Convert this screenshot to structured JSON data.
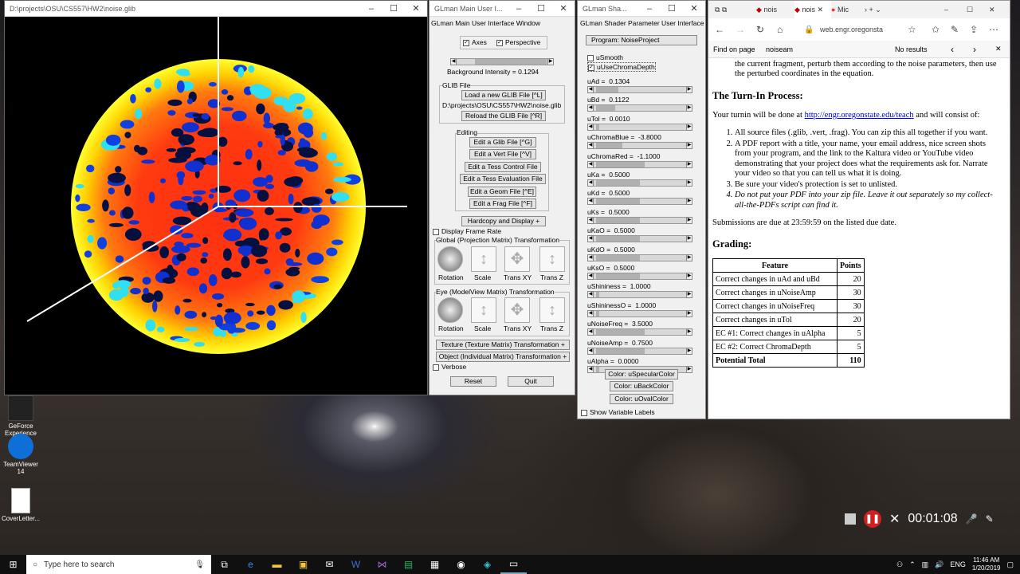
{
  "desktop": {
    "icons": [
      {
        "label": "GeForce Experience"
      },
      {
        "label": "TeamViewer 14"
      },
      {
        "label": "CoverLetter..."
      }
    ]
  },
  "gl_window": {
    "title": "D:\\projects\\OSU\\CS557\\HW2\\noise.glib"
  },
  "main_ui": {
    "title": "GLman Main User I...",
    "inner_title": "GLman Main User Interface Window",
    "axes": "Axes",
    "perspective": "Perspective",
    "bg_intensity": "Background Intensity = 0.1294",
    "glib_file_label": "GLIB File",
    "load_glib": "Load a new GLIB File [^L]",
    "glib_path": "D:\\projects\\OSU\\CS557\\HW2\\noise.glib",
    "reload_glib": "Reload the GLIB File [^R]",
    "editing_label": "Editing",
    "edit_glib": "Edit a Glib File [^G]",
    "edit_vert": "Edit a Vert File [^V]",
    "edit_tess_control": "Edit a Tess Control File",
    "edit_tess_eval": "Edit a Tess Evaluation File",
    "edit_geom": "Edit a Geom File [^E]",
    "edit_frag": "Edit a Frag File [^F]",
    "hardcopy": "Hardcopy and Display +",
    "display_frame_rate": "Display Frame Rate",
    "global_transform": "Global (Projection Matrix) Transformation",
    "eye_transform": "Eye (ModelView Matrix) Transformation",
    "tools": [
      "Rotation",
      "Scale",
      "Trans XY",
      "Trans Z"
    ],
    "texture_transform": "Texture (Texture Matrix) Transformation +",
    "object_transform": "Object (Individual Matrix) Transformation +",
    "verbose": "Verbose",
    "reset": "Reset",
    "quit": "Quit"
  },
  "shader_ui": {
    "title": "GLman Sha...",
    "inner_title": "GLman Shader Parameter User Interface",
    "program": "Program: NoiseProject",
    "usmooth": "uSmooth",
    "uusechroma": "uUseChromaDepth",
    "params": [
      {
        "label": "uAd =",
        "value": "0.1304",
        "fill": 0.25
      },
      {
        "label": "uBd =",
        "value": "0.1122",
        "fill": 0.22
      },
      {
        "label": "uTol =",
        "value": "0.0010",
        "fill": 0.02
      },
      {
        "label": "uChromaBlue =",
        "value": "-3.8000",
        "fill": 0.3
      },
      {
        "label": "uChromaRed =",
        "value": "-1.1000",
        "fill": 0.55
      },
      {
        "label": "uKa =",
        "value": "0.5000",
        "fill": 0.5
      },
      {
        "label": "uKd =",
        "value": "0.5000",
        "fill": 0.5
      },
      {
        "label": "uKs =",
        "value": "0.5000",
        "fill": 0.5
      },
      {
        "label": "uKaO =",
        "value": "0.5000",
        "fill": 0.5
      },
      {
        "label": "uKdO =",
        "value": "0.5000",
        "fill": 0.5
      },
      {
        "label": "uKsO =",
        "value": "0.5000",
        "fill": 0.5
      },
      {
        "label": "uShininess =",
        "value": "1.0000",
        "fill": 0.02
      },
      {
        "label": "uShininessO =",
        "value": "1.0000",
        "fill": 0.02
      },
      {
        "label": "uNoiseFreq =",
        "value": "3.5000",
        "fill": 0.55
      },
      {
        "label": "uNoiseAmp =",
        "value": "0.7500",
        "fill": 0.55
      },
      {
        "label": "uAlpha =",
        "value": "0.0000",
        "fill": 0.0
      }
    ],
    "color_specular": "Color: uSpecularColor",
    "color_back": "Color: uBackColor",
    "color_oval": "Color: uOvalColor",
    "show_var_labels": "Show Variable Labels"
  },
  "browser": {
    "tabs": [
      "nois",
      "nois",
      "Mic"
    ],
    "url": "web.engr.oregonsta",
    "find_label": "Find on page",
    "find_value": "noiseam",
    "find_results": "No results",
    "para_cut": "the current fragment, perturb them according to the noise parameters, then use the perturbed coordinates in the equation.",
    "turnin_heading": "The Turn-In Process:",
    "turnin_p1": "Your turnin will be done at",
    "turnin_link": "http://engr.oregonstate.edu/teach",
    "turnin_p2": "and will consist of:",
    "list": [
      "All source files (.glib, .vert, .frag). You can zip this all together if you want.",
      "A PDF report with a title, your name, your email address, nice screen shots from your program, and the link to the Kaltura video or YouTube video demonstrating that your project does what the requirements ask for. Narrate your video so that you can tell us what it is doing.",
      "Be sure your video's protection is set to unlisted.",
      "Do not put your PDF into your zip file. Leave it out separately so my collect-all-the-PDFs script can find it."
    ],
    "due": "Submissions are due at 23:59:59 on the listed due date.",
    "grading_heading": "Grading:",
    "table_headers": [
      "Feature",
      "Points"
    ],
    "table_rows": [
      [
        "Correct changes in uAd and uBd",
        "20"
      ],
      [
        "Correct changes in uNoiseAmp",
        "30"
      ],
      [
        "Correct changes in uNoiseFreq",
        "30"
      ],
      [
        "Correct changes in uTol",
        "20"
      ],
      [
        "EC #1: Correct changes in uAlpha",
        "5"
      ],
      [
        "EC #2: Correct ChromaDepth",
        "5"
      ]
    ],
    "total_label": "Potential Total",
    "total_value": "110"
  },
  "recorder": {
    "time": "00:01:08"
  },
  "taskbar": {
    "search_placeholder": "Type here to search",
    "lang": "ENG",
    "time": "11:46 AM",
    "date": "1/20/2019"
  }
}
